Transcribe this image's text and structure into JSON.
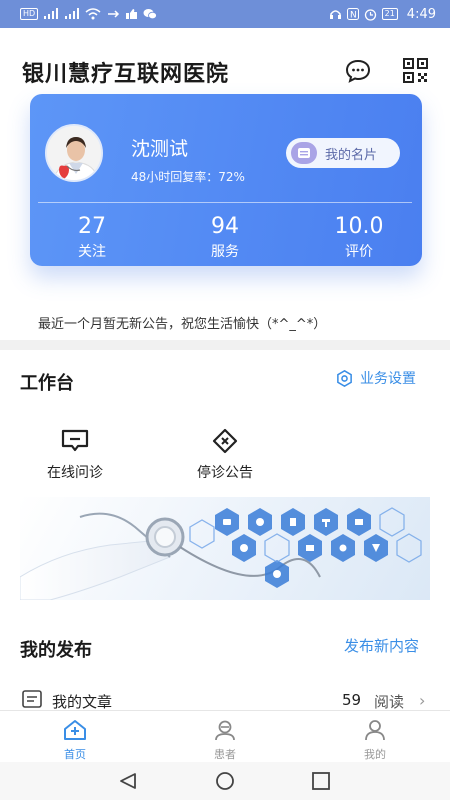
{
  "status_bar": {
    "left_icons": [
      "hd-icon",
      "signal-4g-icon",
      "signal-4g-icon",
      "wifi-icon",
      "usb-icon",
      "thumbs-up-icon",
      "wechat-icon"
    ],
    "hd_label": "HD",
    "right_icons": [
      "headset-icon",
      "nfc-icon",
      "alarm-icon",
      "battery-icon"
    ],
    "battery": "21",
    "time": "4:49"
  },
  "header": {
    "title": "银川慧疗互联网医院",
    "icons": [
      "chat-bubble-icon",
      "qr-code-icon"
    ]
  },
  "profile": {
    "name": "沈测试",
    "rate": "48小时回复率：72%",
    "card_button": "我的名片",
    "stats": [
      {
        "value": "27",
        "label": "关注"
      },
      {
        "value": "94",
        "label": "服务"
      },
      {
        "value": "10.0",
        "label": "评价"
      }
    ],
    "accent": "#4a7ff0"
  },
  "notice": "最近一个月暂无新公告，祝您生活愉快（*^_^*）",
  "workbench": {
    "title": "工作台",
    "settings_label": "业务设置",
    "tools": [
      {
        "label": "在线问诊",
        "icon": "chat-box-icon"
      },
      {
        "label": "停诊公告",
        "icon": "cancel-diamond-icon"
      }
    ]
  },
  "publish": {
    "title": "我的发布",
    "new_link": "发布新内容",
    "articles": {
      "label": "我的文章",
      "count": "59",
      "unit": "阅读"
    }
  },
  "bottom_nav": [
    {
      "label": "首页",
      "icon": "home-plus-icon",
      "active": true
    },
    {
      "label": "患者",
      "icon": "patients-icon",
      "active": false
    },
    {
      "label": "我的",
      "icon": "person-icon",
      "active": false
    }
  ],
  "colors": {
    "link": "#3a8ee6",
    "status_bar": "#6e8fd8"
  }
}
